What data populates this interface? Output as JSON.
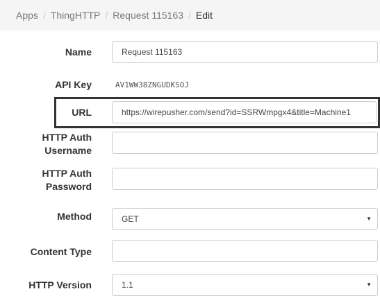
{
  "breadcrumb": {
    "items": [
      "Apps",
      "ThingHTTP",
      "Request 115163",
      "Edit"
    ],
    "separator": "/"
  },
  "form": {
    "name": {
      "label": "Name",
      "value": "Request 115163"
    },
    "api_key": {
      "label": "API Key",
      "value": "AV1WW38ZNGUDKSOJ"
    },
    "url": {
      "label": "URL",
      "value": "https://wirepusher.com/send?id=SSRWmpgx4&title=Machine1"
    },
    "http_auth_username": {
      "label_line1": "HTTP Auth",
      "label_line2": "Username",
      "value": ""
    },
    "http_auth_password": {
      "label_line1": "HTTP Auth",
      "label_line2": "Password",
      "value": ""
    },
    "method": {
      "label": "Method",
      "value": "GET"
    },
    "content_type": {
      "label": "Content Type",
      "value": ""
    },
    "http_version": {
      "label": "HTTP Version",
      "value": "1.1"
    }
  },
  "icons": {
    "select_arrow": "chevron-down-icon"
  },
  "colors": {
    "breadcrumb_bg": "#f5f5f5",
    "highlight_border": "#333333",
    "input_border": "#cccccc"
  }
}
